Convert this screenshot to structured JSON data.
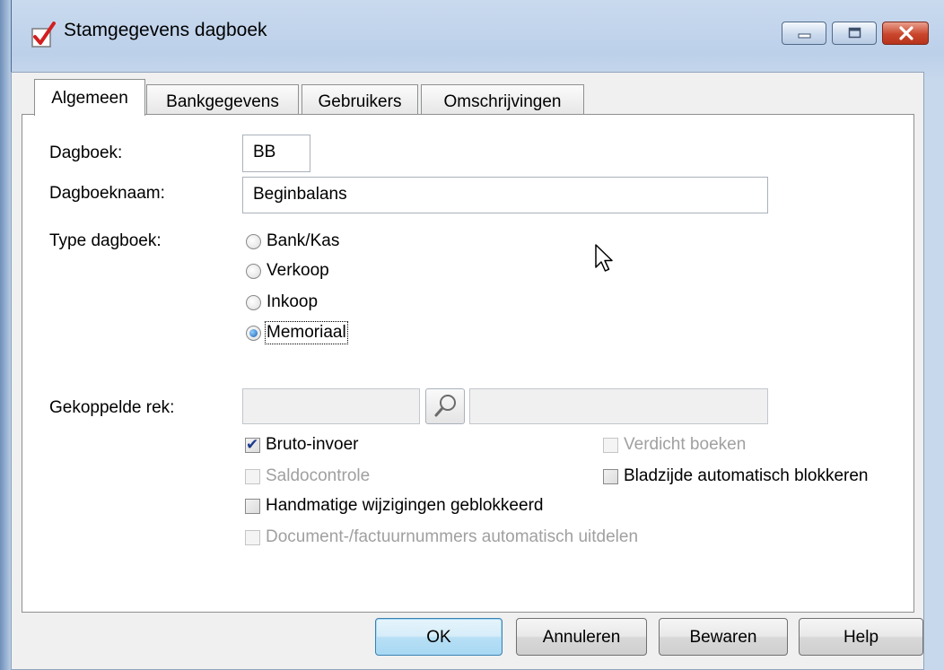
{
  "window": {
    "title": "Stamgegevens dagboek"
  },
  "tabs": [
    {
      "label": "Algemeen"
    },
    {
      "label": "Bankgegevens"
    },
    {
      "label": "Gebruikers"
    },
    {
      "label": "Omschrijvingen"
    }
  ],
  "form": {
    "dagboek_label": "Dagboek:",
    "dagboek_value": "BB",
    "dagboeknaam_label": "Dagboeknaam:",
    "dagboeknaam_value": "Beginbalans",
    "type_label": "Type dagboek:",
    "type_options": [
      {
        "label": "Bank/Kas",
        "selected": false
      },
      {
        "label": "Verkoop",
        "selected": false
      },
      {
        "label": "Inkoop",
        "selected": false
      },
      {
        "label": "Memoriaal",
        "selected": true
      }
    ],
    "gekoppelde_label": "Gekoppelde rek:",
    "gekoppelde_code": "",
    "gekoppelde_name": ""
  },
  "checkboxes": {
    "bruto_invoer": {
      "label": "Bruto-invoer",
      "checked": true,
      "enabled": true
    },
    "verdicht_boeken": {
      "label": "Verdicht boeken",
      "checked": false,
      "enabled": false
    },
    "saldocontrole": {
      "label": "Saldocontrole",
      "checked": false,
      "enabled": false
    },
    "bladzijde_blokkeren": {
      "label": "Bladzijde automatisch blokkeren",
      "checked": false,
      "enabled": true
    },
    "handmatige_wijzigingen": {
      "label": "Handmatige wijzigingen geblokkeerd",
      "checked": false,
      "enabled": true
    },
    "document_nummers": {
      "label": "Document-/factuurnummers automatisch uitdelen",
      "checked": false,
      "enabled": false
    }
  },
  "buttons": {
    "ok": "OK",
    "annuleren": "Annuleren",
    "bewaren": "Bewaren",
    "help": "Help"
  },
  "colors": {
    "title_bar": "#bcd0ea",
    "close_button": "#c9462c",
    "default_button": "#a8d8f3",
    "checkmark": "#1d3a8f"
  },
  "icons": {
    "app": "red-checkmark-icon",
    "search": "magnifier-icon",
    "minimize": "minimize-icon",
    "maximize": "maximize-icon",
    "close": "close-icon",
    "cursor": "mouse-pointer-icon"
  }
}
